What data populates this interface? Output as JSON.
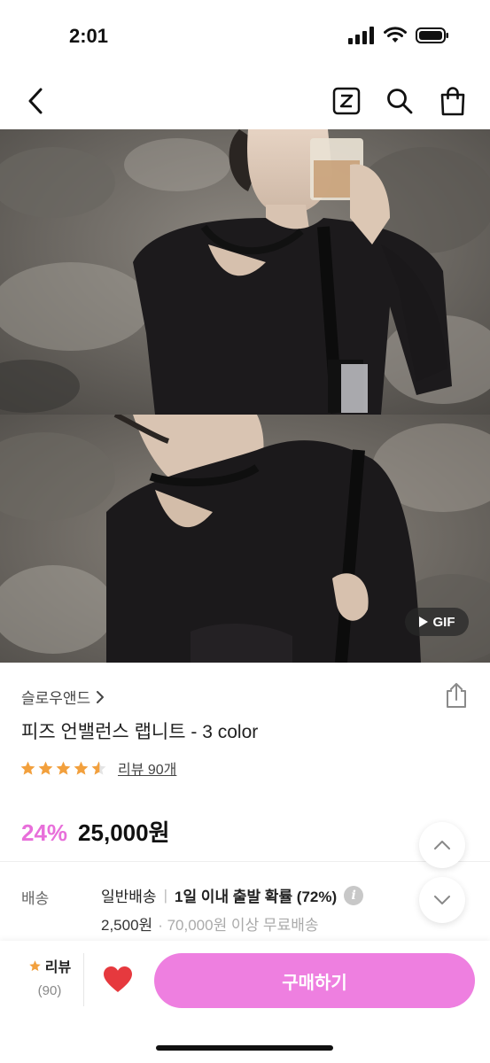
{
  "status_bar": {
    "time": "2:01"
  },
  "nav": {
    "back_icon": "chevron-left-icon",
    "z_icon": "z-logo-icon",
    "search_icon": "search-icon",
    "bag_icon": "shopping-bag-icon"
  },
  "media": {
    "gif_label": "GIF"
  },
  "product": {
    "brand": "슬로우앤드",
    "title": "피즈 언밸런스 랩니트 - 3 color",
    "rating_stars": 4.5,
    "review_link": "리뷰 90개",
    "discount": "24%",
    "price": "25,000원"
  },
  "shipping": {
    "label": "배송",
    "type": "일반배송",
    "separator": "|",
    "eta": "1일 이내 출발 확률 (72%)",
    "fee": "2,500원",
    "free_note": "· 70,000원 이상 무료배송"
  },
  "bottom_bar": {
    "review_label": "리뷰",
    "review_count": "(90)",
    "buy_label": "구매하기"
  },
  "colors": {
    "accent_pink": "#ee7fe0",
    "discount_pink": "#e86fda",
    "star_orange": "#f2a03d",
    "heart_red": "#e6393e"
  }
}
